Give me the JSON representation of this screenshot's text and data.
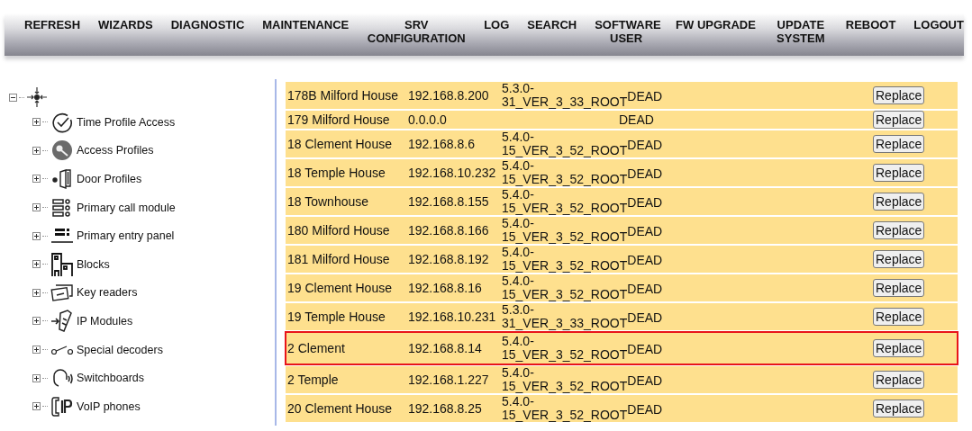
{
  "menu": [
    {
      "label": "REFRESH"
    },
    {
      "label": "WIZARDS"
    },
    {
      "label": "DIAGNOSTIC"
    },
    {
      "label": "MAINTENANCE"
    },
    {
      "label": "SRV CONFIGURATION"
    },
    {
      "label": "LOG"
    },
    {
      "label": "SEARCH"
    },
    {
      "label": "SOFTWARE USER"
    },
    {
      "label": "FW UPGRADE"
    },
    {
      "label": "UPDATE SYSTEM"
    },
    {
      "label": "REBOOT"
    },
    {
      "label": "LOGOUT"
    }
  ],
  "tree": {
    "expanded": true,
    "children": [
      {
        "label": "Time Profile Access",
        "expanded": false
      },
      {
        "label": "Access Profiles",
        "expanded": false
      },
      {
        "label": "Door Profiles",
        "expanded": false
      },
      {
        "label": "Primary call module",
        "expanded": false
      },
      {
        "label": "Primary entry panel",
        "expanded": false
      },
      {
        "label": "Blocks",
        "expanded": false
      },
      {
        "label": "Key readers",
        "expanded": false
      },
      {
        "label": "IP Modules",
        "expanded": false
      },
      {
        "label": "Special decoders",
        "expanded": false
      },
      {
        "label": "Switchboards",
        "expanded": false
      },
      {
        "label": "VoIP phones",
        "expanded": false
      }
    ]
  },
  "devices": [
    {
      "name": "178B Milford House",
      "ip": "192.168.8.200",
      "version": "5.3.0-31_VER_3_33_ROOT",
      "status": "DEAD",
      "action": "Replace",
      "highlighted": false
    },
    {
      "name": "179 Milford House",
      "ip": "0.0.0.0",
      "status": "DEAD",
      "action": "Replace",
      "highlighted": false
    },
    {
      "name": "18 Clement House",
      "ip": "192.168.8.6",
      "version": "5.4.0-15_VER_3_52_ROOT",
      "status": "DEAD",
      "action": "Replace",
      "highlighted": false
    },
    {
      "name": "18 Temple House",
      "ip": "192.168.10.232",
      "version": "5.4.0-15_VER_3_52_ROOT",
      "status": "DEAD",
      "action": "Replace",
      "highlighted": false
    },
    {
      "name": "18 Townhouse",
      "ip": "192.168.8.155",
      "version": "5.4.0-15_VER_3_52_ROOT",
      "status": "DEAD",
      "action": "Replace",
      "highlighted": false
    },
    {
      "name": "180 Milford House",
      "ip": "192.168.8.166",
      "version": "5.4.0-15_VER_3_52_ROOT",
      "status": "DEAD",
      "action": "Replace",
      "highlighted": false
    },
    {
      "name": "181 Milford House",
      "ip": "192.168.8.192",
      "version": "5.4.0-15_VER_3_52_ROOT",
      "status": "DEAD",
      "action": "Replace",
      "highlighted": false
    },
    {
      "name": "19 Clement House",
      "ip": "192.168.8.16",
      "version": "5.4.0-15_VER_3_52_ROOT",
      "status": "DEAD",
      "action": "Replace",
      "highlighted": false
    },
    {
      "name": "19 Temple House",
      "ip": "192.168.10.231",
      "version": "5.3.0-31_VER_3_33_ROOT",
      "status": "DEAD",
      "action": "Replace",
      "highlighted": false
    },
    {
      "name": "2 Clement",
      "ip": "192.168.8.14",
      "version": "5.4.0-15_VER_3_52_ROOT",
      "status": "DEAD",
      "action": "Replace",
      "highlighted": true
    },
    {
      "name": "2 Temple",
      "ip": "192.168.1.227",
      "version": "5.4.0-15_VER_3_52_ROOT",
      "status": "DEAD",
      "action": "Replace",
      "highlighted": false
    },
    {
      "name": "20 Clement House",
      "ip": "192.168.8.25",
      "version": "5.4.0-15_VER_3_52_ROOT",
      "status": "DEAD",
      "action": "Replace",
      "highlighted": false
    }
  ]
}
